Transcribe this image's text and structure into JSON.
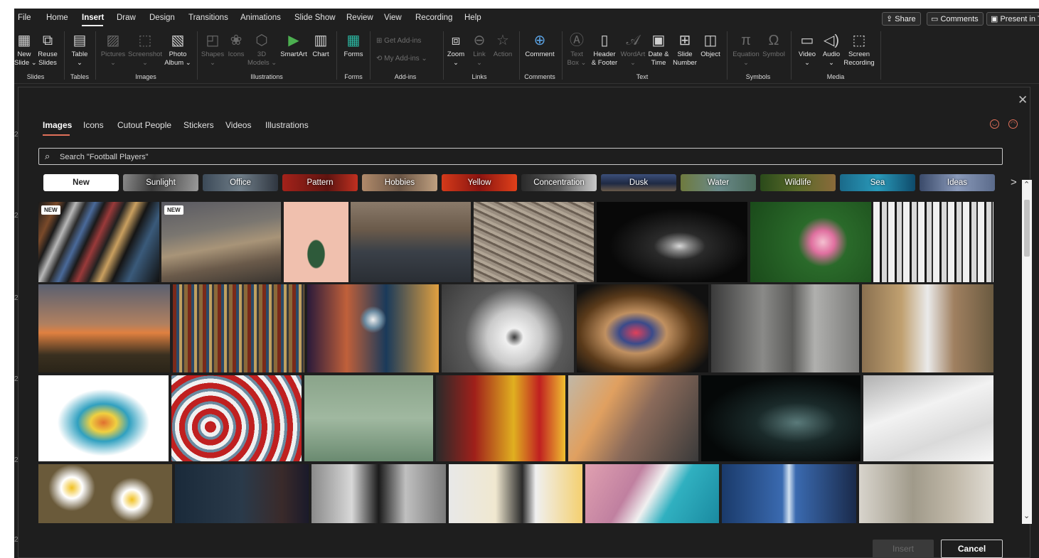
{
  "menu": [
    {
      "id": "file",
      "label": "File"
    },
    {
      "id": "home",
      "label": "Home"
    },
    {
      "id": "insert",
      "label": "Insert",
      "active": true
    },
    {
      "id": "draw",
      "label": "Draw"
    },
    {
      "id": "design",
      "label": "Design"
    },
    {
      "id": "transitions",
      "label": "Transitions"
    },
    {
      "id": "animations",
      "label": "Animations"
    },
    {
      "id": "slide-show",
      "label": "Slide Show"
    },
    {
      "id": "review",
      "label": "Review"
    },
    {
      "id": "view",
      "label": "View"
    },
    {
      "id": "recording",
      "label": "Recording"
    },
    {
      "id": "help",
      "label": "Help"
    }
  ],
  "topright": {
    "share": "Share",
    "comments": "Comments",
    "present": "Present in T"
  },
  "ribbon": {
    "groups": {
      "slides": "Slides",
      "tables": "Tables",
      "images": "Images",
      "illustrations": "Illustrations",
      "forms": "Forms",
      "addins": "Add-ins",
      "links": "Links",
      "comments": "Comments",
      "text": "Text",
      "symbols": "Symbols",
      "media": "Media"
    },
    "buttons": {
      "new_slide": [
        "New",
        "Slide ⌄"
      ],
      "reuse_slides": [
        "Reuse",
        "Slides"
      ],
      "table": [
        "Table",
        "⌄"
      ],
      "pictures": [
        "Pictures",
        "⌄"
      ],
      "screenshot": [
        "Screenshot",
        "⌄"
      ],
      "photo_album": [
        "Photo",
        "Album ⌄"
      ],
      "shapes": [
        "Shapes",
        "⌄"
      ],
      "icons": [
        "Icons",
        ""
      ],
      "models3d": [
        "3D",
        "Models ⌄"
      ],
      "smartart": [
        "SmartArt",
        ""
      ],
      "chart": [
        "Chart",
        ""
      ],
      "forms": [
        "Forms",
        ""
      ],
      "get_addins": "Get Add-ins",
      "my_addins": "My Add-ins ⌄",
      "zoom": [
        "Zoom",
        "⌄"
      ],
      "link": [
        "Link",
        "⌄"
      ],
      "action": [
        "Action",
        ""
      ],
      "comment": [
        "Comment",
        ""
      ],
      "textbox": [
        "Text",
        "Box ⌄"
      ],
      "header_footer": [
        "Header",
        "& Footer"
      ],
      "wordart": [
        "WordArt",
        "⌄"
      ],
      "date_time": [
        "Date &",
        "Time"
      ],
      "slide_number": [
        "Slide",
        "Number"
      ],
      "object": [
        "Object",
        ""
      ],
      "equation": [
        "Equation",
        "⌄"
      ],
      "symbol": [
        "Symbol",
        ""
      ],
      "video": [
        "Video",
        "⌄"
      ],
      "audio": [
        "Audio",
        "⌄"
      ],
      "screen_recording": [
        "Screen",
        "Recording"
      ]
    }
  },
  "gutter_numbers": [
    "2",
    "2",
    "2",
    "2",
    "2",
    "2",
    "2"
  ],
  "dialog": {
    "close_glyph": "✕",
    "tabs": [
      {
        "id": "images",
        "label": "Images",
        "active": true
      },
      {
        "id": "icons",
        "label": "Icons"
      },
      {
        "id": "cutout-people",
        "label": "Cutout People"
      },
      {
        "id": "stickers",
        "label": "Stickers"
      },
      {
        "id": "videos",
        "label": "Videos"
      },
      {
        "id": "illustrations",
        "label": "Illustrations"
      }
    ],
    "search_placeholder": "Search \"Football Players\"",
    "chips": [
      "New",
      "Sunlight",
      "Office",
      "Pattern",
      "Hobbies",
      "Yellow",
      "Concentration",
      "Dusk",
      "Water",
      "Wildlife",
      "Sea",
      "Ideas"
    ],
    "badge_label": "NEW",
    "insert_label": "Insert",
    "cancel_label": "Cancel"
  },
  "colors": {
    "accent": "#e0705a",
    "window_bg": "#1f1f1f",
    "dialog_bg": "#1e1e1e"
  },
  "tiles": [
    {
      "name": "tile-bookshelf-books",
      "badge": true
    },
    {
      "name": "tile-coastal-dunes",
      "badge": true
    },
    {
      "name": "tile-cactus-pink"
    },
    {
      "name": "tile-woman-meditating"
    },
    {
      "name": "tile-wood-grain"
    },
    {
      "name": "tile-tiara"
    },
    {
      "name": "tile-frangipani-flower"
    },
    {
      "name": "tile-birch-trees"
    },
    {
      "name": "tile-girl-sunset"
    },
    {
      "name": "tile-bookshelf"
    },
    {
      "name": "tile-crystal-ball-bokeh"
    },
    {
      "name": "tile-spiral-staircase"
    },
    {
      "name": "tile-mandrill"
    },
    {
      "name": "tile-concrete-corridor"
    },
    {
      "name": "tile-warehouse-worker"
    },
    {
      "name": "tile-colorful-smoke"
    },
    {
      "name": "tile-beach-umbrellas"
    },
    {
      "name": "tile-paper-people"
    },
    {
      "name": "tile-woman-red-headwrap"
    },
    {
      "name": "tile-man-with-cat"
    },
    {
      "name": "tile-particle-wave"
    },
    {
      "name": "tile-open-book-pages"
    },
    {
      "name": "tile-daisies"
    },
    {
      "name": "tile-woman-desk-lamp"
    },
    {
      "name": "tile-businesswoman-city"
    },
    {
      "name": "tile-phone-sticky-notes"
    },
    {
      "name": "tile-pink-beach-wave"
    },
    {
      "name": "tile-lab-equipment"
    },
    {
      "name": "tile-home-office"
    }
  ]
}
